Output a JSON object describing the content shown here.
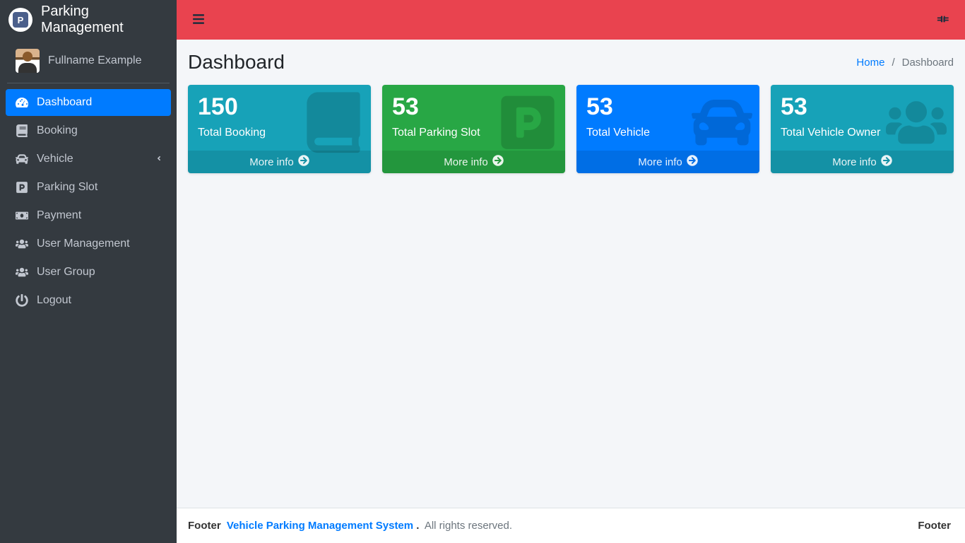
{
  "brand": {
    "title": "Parking Management",
    "logo_text": "P"
  },
  "user": {
    "fullname": "Fullname Example"
  },
  "nav": {
    "dashboard": "Dashboard",
    "booking": "Booking",
    "vehicle": "Vehicle",
    "parking_slot": "Parking Slot",
    "payment": "Payment",
    "user_management": "User Management",
    "user_group": "User Group",
    "logout": "Logout"
  },
  "header": {
    "title": "Dashboard",
    "breadcrumb": {
      "home": "Home",
      "current": "Dashboard"
    }
  },
  "cards": {
    "booking": {
      "value": "150",
      "label": "Total Booking",
      "more": "More info"
    },
    "parking_slot": {
      "value": "53",
      "label": "Total Parking Slot",
      "more": "More info"
    },
    "vehicle": {
      "value": "53",
      "label": "Total Vehicle",
      "more": "More info"
    },
    "vehicle_owner": {
      "value": "53",
      "label": "Total Vehicle Owner",
      "more": "More info"
    }
  },
  "footer": {
    "left_prefix": "Footer",
    "link_text": "Vehicle Parking Management System",
    "dot": ".",
    "rights": "All rights reserved.",
    "right_text": "Footer"
  }
}
